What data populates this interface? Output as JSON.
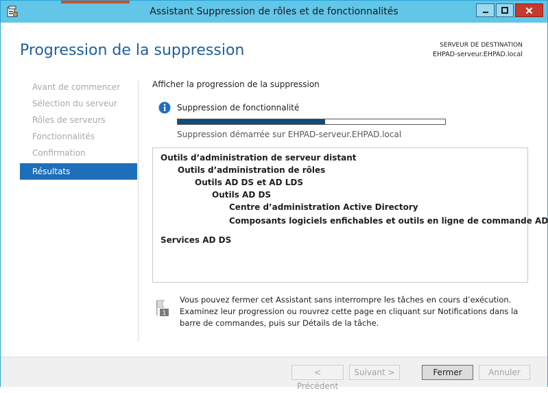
{
  "window": {
    "title": "Assistant Suppression de rôles et de fonctionnalités"
  },
  "header": {
    "title": "Progression de la suppression",
    "destination_label": "SERVEUR DE DESTINATION",
    "destination_server": "EHPAD-serveur.EHPAD.local"
  },
  "nav": {
    "items": [
      {
        "label": "Avant de commencer"
      },
      {
        "label": "Sélection du serveur"
      },
      {
        "label": "Rôles de serveurs"
      },
      {
        "label": "Fonctionnalités"
      },
      {
        "label": "Confirmation"
      },
      {
        "label": "Résultats"
      }
    ],
    "active_index": 5
  },
  "main": {
    "section_label": "Afficher la progression de la suppression",
    "status_title": "Suppression de fonctionnalité",
    "progress_fraction": 0.55,
    "progress_text": "Suppression démarrée sur EHPAD-serveur.EHPAD.local",
    "results": [
      {
        "label": "Outils d’administration de serveur distant",
        "level": 0
      },
      {
        "label": "Outils d’administration de rôles",
        "level": 1
      },
      {
        "label": "Outils AD DS et AD LDS",
        "level": 2
      },
      {
        "label": "Outils AD DS",
        "level": 3
      },
      {
        "label": "Centre d’administration Active Directory",
        "level": 4
      },
      {
        "label": "Composants logiciels enfichables et outils en ligne de commande AD DS",
        "level": 4
      },
      {
        "label": "Services AD DS",
        "level": 0
      }
    ],
    "note": "Vous pouvez fermer cet Assistant sans interrompre les tâches en cours d’exécution. Examinez leur progression ou rouvrez cette page en cliquant sur Notifications dans la barre de commandes, puis sur Détails de la tâche.",
    "note_badge": "1"
  },
  "footer": {
    "previous_label": "< Précédent",
    "next_label": "Suivant >",
    "close_label": "Fermer",
    "cancel_label": "Annuler"
  },
  "colors": {
    "titlebar": "#62c6e9",
    "accent": "#1e6fba",
    "progress": "#0e4d7c",
    "close_button": "#c73a2d"
  },
  "icons": [
    "app-icon",
    "minimize-icon",
    "maximize-icon",
    "close-icon",
    "info-icon",
    "flag-note-icon"
  ]
}
